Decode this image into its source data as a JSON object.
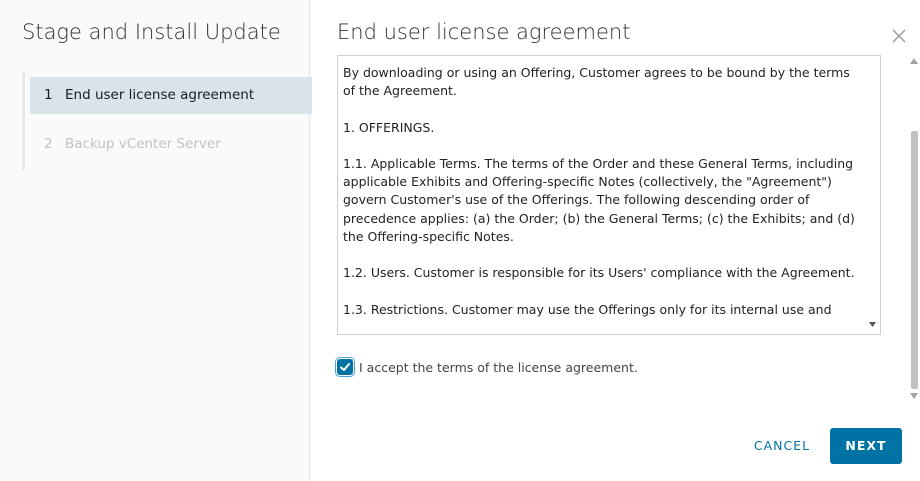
{
  "wizard": {
    "title": "Stage and Install Update",
    "steps": [
      {
        "number": "1",
        "label": "End user license agreement",
        "state": "active"
      },
      {
        "number": "2",
        "label": "Backup vCenter Server",
        "state": "disabled"
      }
    ]
  },
  "dialog": {
    "title": "End user license agreement",
    "close_icon": "close-icon"
  },
  "eula": {
    "paragraphs": [
      "By downloading or using an Offering, Customer agrees to be bound by the terms of the Agreement.",
      "1. OFFERINGS.",
      "1.1. Applicable Terms. The terms of the Order and these General Terms, including applicable Exhibits and Offering-specific Notes (collectively, the \"Agreement\") govern Customer's use of the Offerings. The following descending order of precedence applies: (a) the Order; (b) the General Terms; (c) the Exhibits; and (d) the Offering-specific Notes.",
      "1.2. Users. Customer is responsible for its Users' compliance with the Agreement.",
      "1.3. Restrictions. Customer may use the Offerings only for its internal use and"
    ]
  },
  "accept": {
    "checked": true,
    "label": "I accept the terms of the license agreement."
  },
  "footer": {
    "cancel_label": "CANCEL",
    "next_label": "NEXT"
  },
  "colors": {
    "primary": "#0072a3",
    "active_step_bg": "#d9e4ea",
    "sidebar_bg": "#fafafa"
  }
}
